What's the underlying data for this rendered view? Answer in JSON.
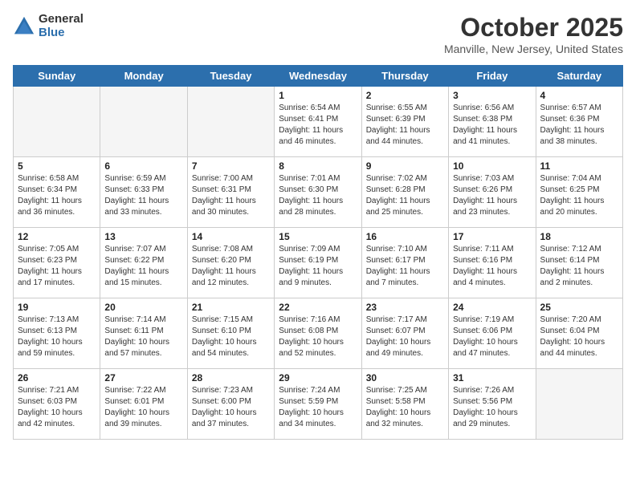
{
  "header": {
    "logo_general": "General",
    "logo_blue": "Blue",
    "title": "October 2025",
    "subtitle": "Manville, New Jersey, United States"
  },
  "weekdays": [
    "Sunday",
    "Monday",
    "Tuesday",
    "Wednesday",
    "Thursday",
    "Friday",
    "Saturday"
  ],
  "weeks": [
    [
      {
        "day": "",
        "empty": true
      },
      {
        "day": "",
        "empty": true
      },
      {
        "day": "",
        "empty": true
      },
      {
        "day": "1",
        "sunrise": "Sunrise: 6:54 AM",
        "sunset": "Sunset: 6:41 PM",
        "daylight": "Daylight: 11 hours and 46 minutes."
      },
      {
        "day": "2",
        "sunrise": "Sunrise: 6:55 AM",
        "sunset": "Sunset: 6:39 PM",
        "daylight": "Daylight: 11 hours and 44 minutes."
      },
      {
        "day": "3",
        "sunrise": "Sunrise: 6:56 AM",
        "sunset": "Sunset: 6:38 PM",
        "daylight": "Daylight: 11 hours and 41 minutes."
      },
      {
        "day": "4",
        "sunrise": "Sunrise: 6:57 AM",
        "sunset": "Sunset: 6:36 PM",
        "daylight": "Daylight: 11 hours and 38 minutes."
      }
    ],
    [
      {
        "day": "5",
        "sunrise": "Sunrise: 6:58 AM",
        "sunset": "Sunset: 6:34 PM",
        "daylight": "Daylight: 11 hours and 36 minutes."
      },
      {
        "day": "6",
        "sunrise": "Sunrise: 6:59 AM",
        "sunset": "Sunset: 6:33 PM",
        "daylight": "Daylight: 11 hours and 33 minutes."
      },
      {
        "day": "7",
        "sunrise": "Sunrise: 7:00 AM",
        "sunset": "Sunset: 6:31 PM",
        "daylight": "Daylight: 11 hours and 30 minutes."
      },
      {
        "day": "8",
        "sunrise": "Sunrise: 7:01 AM",
        "sunset": "Sunset: 6:30 PM",
        "daylight": "Daylight: 11 hours and 28 minutes."
      },
      {
        "day": "9",
        "sunrise": "Sunrise: 7:02 AM",
        "sunset": "Sunset: 6:28 PM",
        "daylight": "Daylight: 11 hours and 25 minutes."
      },
      {
        "day": "10",
        "sunrise": "Sunrise: 7:03 AM",
        "sunset": "Sunset: 6:26 PM",
        "daylight": "Daylight: 11 hours and 23 minutes."
      },
      {
        "day": "11",
        "sunrise": "Sunrise: 7:04 AM",
        "sunset": "Sunset: 6:25 PM",
        "daylight": "Daylight: 11 hours and 20 minutes."
      }
    ],
    [
      {
        "day": "12",
        "sunrise": "Sunrise: 7:05 AM",
        "sunset": "Sunset: 6:23 PM",
        "daylight": "Daylight: 11 hours and 17 minutes."
      },
      {
        "day": "13",
        "sunrise": "Sunrise: 7:07 AM",
        "sunset": "Sunset: 6:22 PM",
        "daylight": "Daylight: 11 hours and 15 minutes."
      },
      {
        "day": "14",
        "sunrise": "Sunrise: 7:08 AM",
        "sunset": "Sunset: 6:20 PM",
        "daylight": "Daylight: 11 hours and 12 minutes."
      },
      {
        "day": "15",
        "sunrise": "Sunrise: 7:09 AM",
        "sunset": "Sunset: 6:19 PM",
        "daylight": "Daylight: 11 hours and 9 minutes."
      },
      {
        "day": "16",
        "sunrise": "Sunrise: 7:10 AM",
        "sunset": "Sunset: 6:17 PM",
        "daylight": "Daylight: 11 hours and 7 minutes."
      },
      {
        "day": "17",
        "sunrise": "Sunrise: 7:11 AM",
        "sunset": "Sunset: 6:16 PM",
        "daylight": "Daylight: 11 hours and 4 minutes."
      },
      {
        "day": "18",
        "sunrise": "Sunrise: 7:12 AM",
        "sunset": "Sunset: 6:14 PM",
        "daylight": "Daylight: 11 hours and 2 minutes."
      }
    ],
    [
      {
        "day": "19",
        "sunrise": "Sunrise: 7:13 AM",
        "sunset": "Sunset: 6:13 PM",
        "daylight": "Daylight: 10 hours and 59 minutes."
      },
      {
        "day": "20",
        "sunrise": "Sunrise: 7:14 AM",
        "sunset": "Sunset: 6:11 PM",
        "daylight": "Daylight: 10 hours and 57 minutes."
      },
      {
        "day": "21",
        "sunrise": "Sunrise: 7:15 AM",
        "sunset": "Sunset: 6:10 PM",
        "daylight": "Daylight: 10 hours and 54 minutes."
      },
      {
        "day": "22",
        "sunrise": "Sunrise: 7:16 AM",
        "sunset": "Sunset: 6:08 PM",
        "daylight": "Daylight: 10 hours and 52 minutes."
      },
      {
        "day": "23",
        "sunrise": "Sunrise: 7:17 AM",
        "sunset": "Sunset: 6:07 PM",
        "daylight": "Daylight: 10 hours and 49 minutes."
      },
      {
        "day": "24",
        "sunrise": "Sunrise: 7:19 AM",
        "sunset": "Sunset: 6:06 PM",
        "daylight": "Daylight: 10 hours and 47 minutes."
      },
      {
        "day": "25",
        "sunrise": "Sunrise: 7:20 AM",
        "sunset": "Sunset: 6:04 PM",
        "daylight": "Daylight: 10 hours and 44 minutes."
      }
    ],
    [
      {
        "day": "26",
        "sunrise": "Sunrise: 7:21 AM",
        "sunset": "Sunset: 6:03 PM",
        "daylight": "Daylight: 10 hours and 42 minutes."
      },
      {
        "day": "27",
        "sunrise": "Sunrise: 7:22 AM",
        "sunset": "Sunset: 6:01 PM",
        "daylight": "Daylight: 10 hours and 39 minutes."
      },
      {
        "day": "28",
        "sunrise": "Sunrise: 7:23 AM",
        "sunset": "Sunset: 6:00 PM",
        "daylight": "Daylight: 10 hours and 37 minutes."
      },
      {
        "day": "29",
        "sunrise": "Sunrise: 7:24 AM",
        "sunset": "Sunset: 5:59 PM",
        "daylight": "Daylight: 10 hours and 34 minutes."
      },
      {
        "day": "30",
        "sunrise": "Sunrise: 7:25 AM",
        "sunset": "Sunset: 5:58 PM",
        "daylight": "Daylight: 10 hours and 32 minutes."
      },
      {
        "day": "31",
        "sunrise": "Sunrise: 7:26 AM",
        "sunset": "Sunset: 5:56 PM",
        "daylight": "Daylight: 10 hours and 29 minutes."
      },
      {
        "day": "",
        "empty": true
      }
    ]
  ]
}
